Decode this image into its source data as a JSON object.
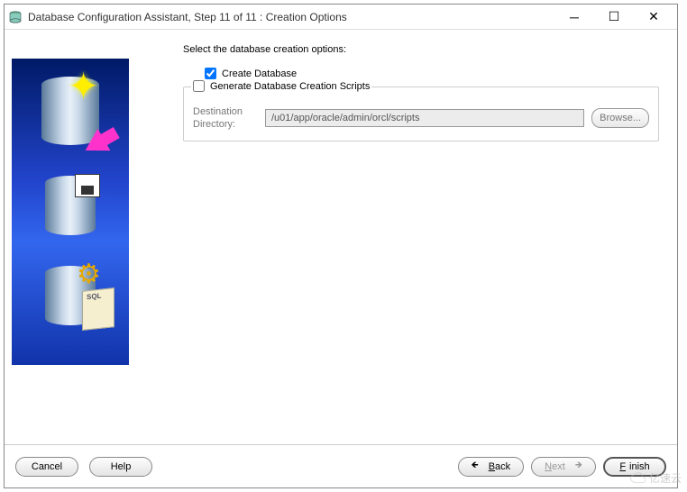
{
  "window": {
    "title": "Database Configuration Assistant, Step 11 of 11 : Creation Options"
  },
  "main": {
    "instruction": "Select the database creation options:",
    "create_db_label": "Create Database",
    "create_db_checked": true,
    "gen_scripts_label": "Generate Database Creation Scripts",
    "gen_scripts_checked": false,
    "dest_label": "Destination Directory:",
    "dest_value": "/u01/app/oracle/admin/orcl/scripts",
    "browse_label": "Browse..."
  },
  "buttons": {
    "cancel": "Cancel",
    "help": "Help",
    "back": "Back",
    "next": "Next",
    "finish": "Finish"
  },
  "watermark": "亿速云"
}
